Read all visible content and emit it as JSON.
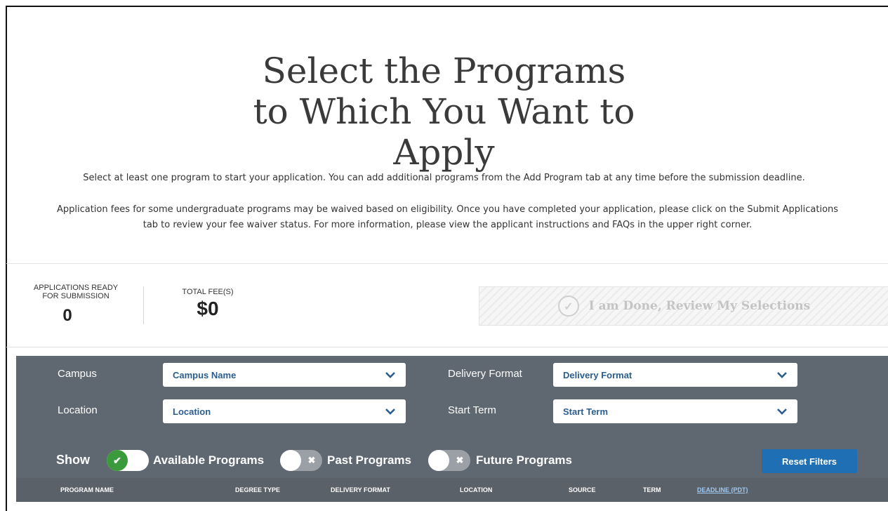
{
  "page": {
    "title_lines": [
      "Select the Programs",
      "to Which You Want to",
      "Apply"
    ],
    "intro_line1": "Select at least one program to start your application. You can add additional programs from the Add Program tab at any time before the submission deadline.",
    "intro_line2a": "Application fees for some undergraduate programs may be waived based on eligibility. Once you have completed your application, please click on the Submit Applications",
    "intro_line2b": "tab to review your fee waiver status. For more information, please view the applicant instructions and FAQs in the upper right corner."
  },
  "summary": {
    "apps_ready_label_1": "APPLICATIONS READY",
    "apps_ready_label_2": "FOR SUBMISSION",
    "apps_ready_value": "0",
    "total_fee_label": "TOTAL FEE(S)",
    "total_fee_value": "$0",
    "done_button_label": "I am Done, Review My Selections"
  },
  "filters": {
    "campus_label": "Campus",
    "campus_value": "Campus Name",
    "delivery_label": "Delivery Format",
    "delivery_value": "Delivery Format",
    "location_label": "Location",
    "location_value": "Location",
    "start_label": "Start Term",
    "start_value": "Start Term",
    "show_label": "Show",
    "available_label": "Available Programs",
    "past_label": "Past Programs",
    "future_label": "Future Programs",
    "available_on": true,
    "past_on": false,
    "future_on": false,
    "reset_label": "Reset Filters"
  },
  "table": {
    "columns": [
      "PROGRAM NAME",
      "DEGREE TYPE",
      "DELIVERY FORMAT",
      "LOCATION",
      "SOURCE",
      "TERM",
      "DEADLINE (PDT)"
    ]
  },
  "colors": {
    "panel_bg": "#5f6870",
    "select_text": "#2b5d8f",
    "toggle_on": "#3b9a3b",
    "reset_button": "#1f6fb5",
    "deadline_link": "#9cc8f2"
  }
}
